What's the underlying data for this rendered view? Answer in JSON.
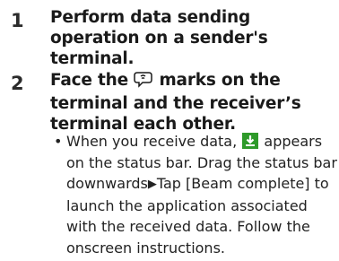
{
  "steps": [
    {
      "number": "1",
      "title": "Perform data sending operation on a sender's terminal."
    },
    {
      "number": "2",
      "title_part1": "Face the",
      "title_part2": "marks on the terminal and the receiver’s terminal each other."
    }
  ],
  "bullet": {
    "dot": "•",
    "text_part1": "When you receive data,",
    "text_part2": "appears on the status bar. Drag the status bar downwards",
    "arrow": "▶",
    "text_part3": "Tap [Beam complete] to launch the application associated with the received data. Follow the onscreen instructions."
  },
  "icons": {
    "nfc_mark": "nfc-mark-icon",
    "status_download": "download-status-icon"
  },
  "colors": {
    "status_icon_green": "#2e9a2a"
  }
}
